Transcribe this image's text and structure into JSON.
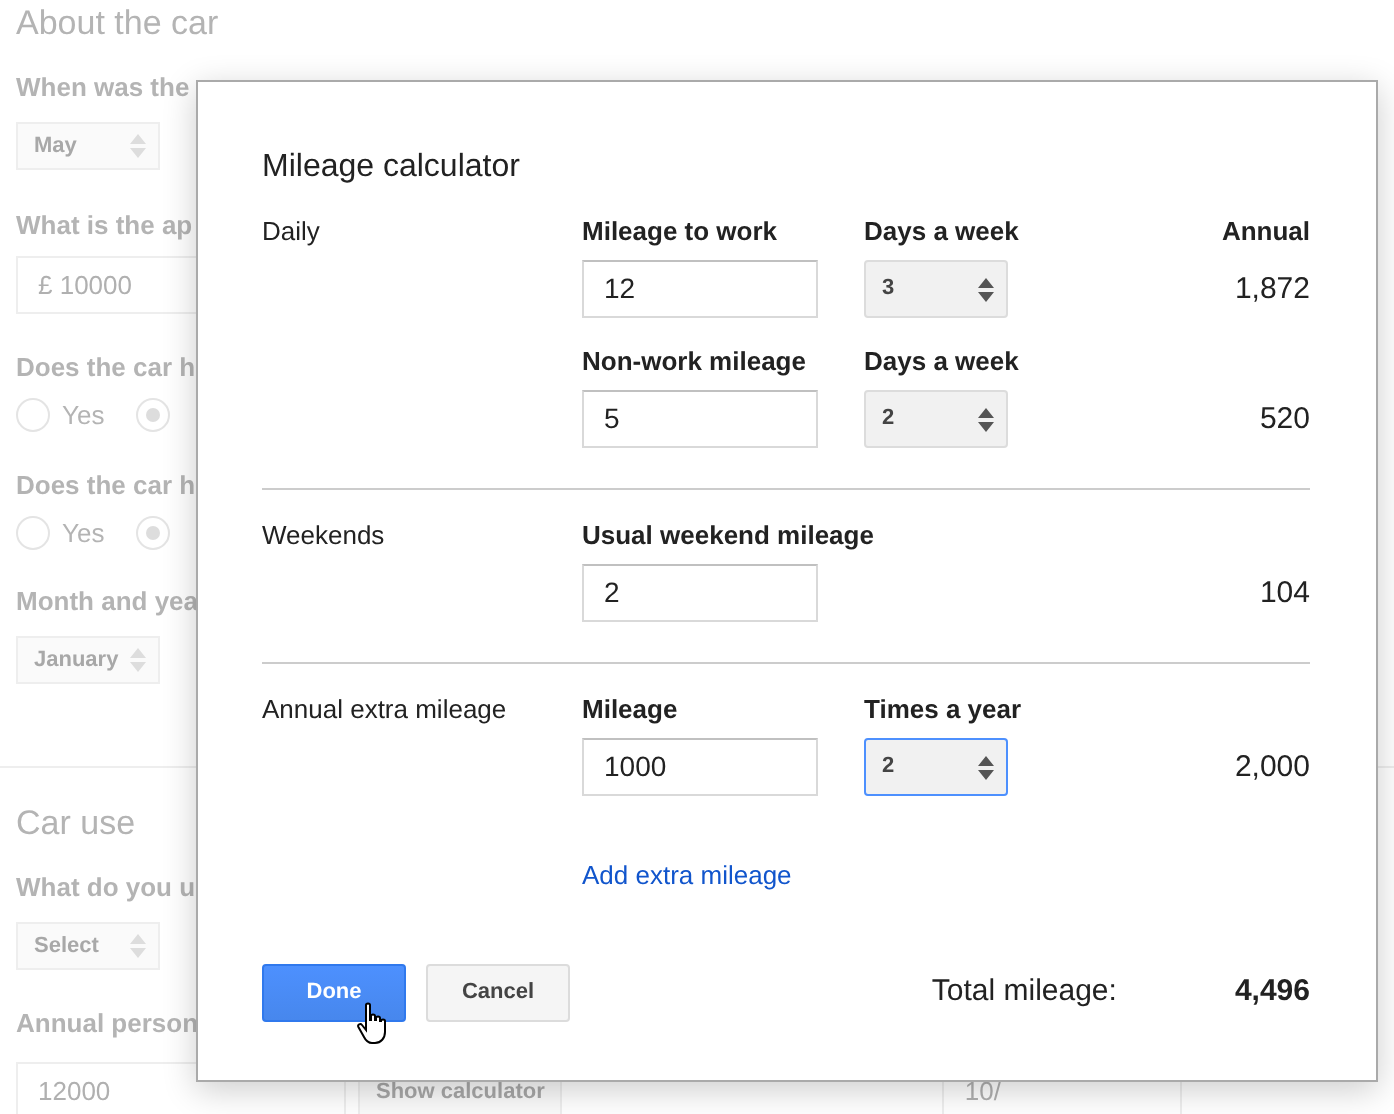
{
  "background": [
    {
      "kind": "heading",
      "text": "About the car"
    },
    {
      "kind": "label",
      "text": "When was the"
    },
    {
      "kind": "selects",
      "values": [
        "May"
      ]
    },
    {
      "kind": "label",
      "text": "What is the ap"
    },
    {
      "kind": "input",
      "prefix": "£",
      "value": "10000"
    },
    {
      "kind": "label",
      "text": "Does the car h"
    },
    {
      "kind": "radios",
      "options": [
        {
          "label": "Yes",
          "selected": false
        },
        {
          "selected": true
        }
      ]
    },
    {
      "kind": "label",
      "text": "Does the car h"
    },
    {
      "kind": "radios",
      "options": [
        {
          "label": "Yes",
          "selected": false
        },
        {
          "selected": true
        }
      ]
    },
    {
      "kind": "label",
      "text": "Month and yea"
    },
    {
      "kind": "selects",
      "values": [
        "January"
      ]
    },
    {
      "kind": "divider"
    },
    {
      "kind": "heading",
      "text": "Car use"
    },
    {
      "kind": "label",
      "text": "What do you u"
    },
    {
      "kind": "selects",
      "values": [
        "Select"
      ]
    },
    {
      "kind": "label",
      "text": "Annual person"
    },
    {
      "kind": "input_row",
      "value": "12000",
      "button": "Show calculator",
      "extra": "10/"
    }
  ],
  "modal": {
    "title": "Mileage calculator",
    "sections": [
      {
        "label": "Daily",
        "rows": [
          {
            "fields": [
              {
                "kind": "input",
                "label": "Mileage to work",
                "value": "12"
              },
              {
                "kind": "select",
                "label": "Days a week",
                "value": "3",
                "focused": false
              }
            ],
            "annual_label": "Annual",
            "annual": "1,872"
          },
          {
            "fields": [
              {
                "kind": "input",
                "label": "Non-work mileage",
                "value": "5"
              },
              {
                "kind": "select",
                "label": "Days a week",
                "value": "2",
                "focused": false
              }
            ],
            "annual": "520"
          }
        ]
      },
      {
        "label": "Weekends",
        "rows": [
          {
            "fields": [
              {
                "kind": "input",
                "label": "Usual weekend mileage",
                "value": "2"
              }
            ],
            "annual": "104"
          }
        ]
      },
      {
        "label": "Annual extra mileage",
        "rows": [
          {
            "fields": [
              {
                "kind": "input",
                "label": "Mileage",
                "value": "1000"
              },
              {
                "kind": "select",
                "label": "Times a year",
                "value": "2",
                "focused": true
              }
            ],
            "annual": "2,000"
          }
        ],
        "link": "Add extra mileage"
      }
    ],
    "buttons": [
      {
        "label": "Done",
        "primary": true
      },
      {
        "label": "Cancel",
        "primary": false
      }
    ],
    "total_label": "Total mileage:",
    "total": "4,496"
  }
}
